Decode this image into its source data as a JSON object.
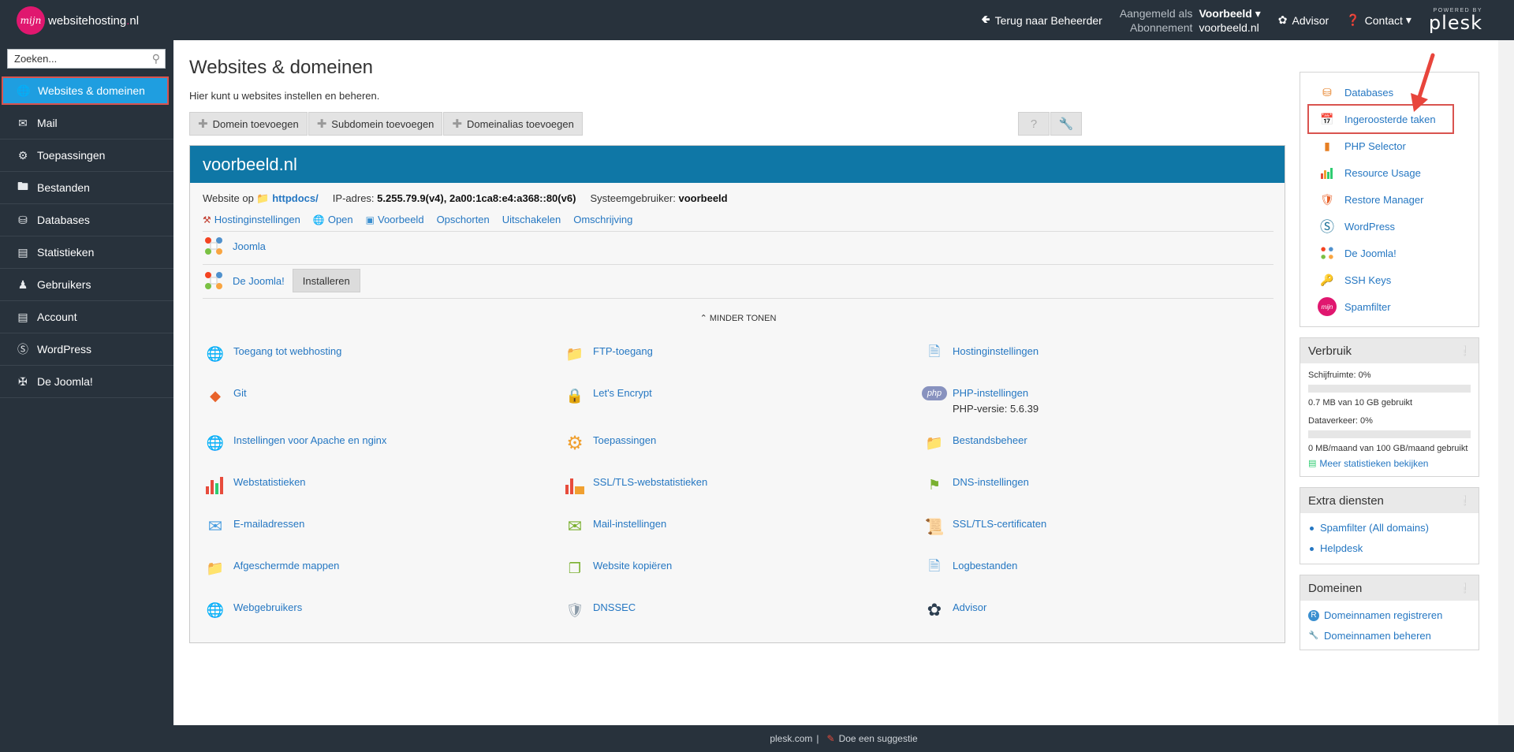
{
  "brand": {
    "logo_circle": "mijn",
    "name": "websitehosting",
    "tld_dot": ".",
    "tld": "nl"
  },
  "topbar": {
    "back_label": "Terug naar Beheerder",
    "logged_in_key": "Aangemeld als",
    "logged_in_user": "Voorbeeld",
    "subscription_key": "Abonnement",
    "subscription_value": "voorbeeld.nl",
    "advisor": "Advisor",
    "contact": "Contact",
    "powered_by": "POWERED BY",
    "plesk": "plesk"
  },
  "sidebar": {
    "search_placeholder": "Zoeken...",
    "items": [
      {
        "label": "Websites & domeinen",
        "icon": "globe-icon"
      },
      {
        "label": "Mail",
        "icon": "mail-icon"
      },
      {
        "label": "Toepassingen",
        "icon": "gear-icon"
      },
      {
        "label": "Bestanden",
        "icon": "folder-icon"
      },
      {
        "label": "Databases",
        "icon": "database-icon"
      },
      {
        "label": "Statistieken",
        "icon": "bar-chart-icon"
      },
      {
        "label": "Gebruikers",
        "icon": "user-icon"
      },
      {
        "label": "Account",
        "icon": "account-icon"
      },
      {
        "label": "WordPress",
        "icon": "wordpress-icon"
      },
      {
        "label": "De Joomla!",
        "icon": "joomla-icon"
      }
    ]
  },
  "main": {
    "title": "Websites & domeinen",
    "subtitle": "Hier kunt u websites instellen en beheren.",
    "toolbar": [
      "Domein toevoegen",
      "Subdomein toevoegen",
      "Domeinalias toevoegen"
    ],
    "help_icon": "?",
    "domain": {
      "name": "voorbeeld.nl",
      "website_op": "Website op",
      "docroot": "httpdocs/",
      "ip_label": "IP-adres:",
      "ip_value": "5.255.79.9(v4), 2a00:1ca8:e4:a368::80(v6)",
      "sysuser_label": "Systeemgebruiker:",
      "sysuser_value": "voorbeeld",
      "links": [
        "Hostinginstellingen",
        "Open",
        "Voorbeeld",
        "Opschorten",
        "Uitschakelen",
        "Omschrijving"
      ],
      "app1": "Joomla",
      "app2": "De Joomla!",
      "install": "Installeren",
      "less": "MINDER TONEN",
      "grid": [
        {
          "label": "Toegang tot webhosting",
          "icon": "hosting-access-icon"
        },
        {
          "label": "FTP-toegang",
          "icon": "ftp-icon"
        },
        {
          "label": "Hostinginstellingen",
          "icon": "hosting-settings-icon"
        },
        {
          "label": "Git",
          "icon": "git-icon"
        },
        {
          "label": "Let's Encrypt",
          "icon": "lets-encrypt-icon"
        },
        {
          "label": "PHP-instellingen",
          "icon": "php-icon",
          "sub": "PHP-versie: 5.6.39"
        },
        {
          "label": "Instellingen voor Apache en nginx",
          "icon": "apache-nginx-icon"
        },
        {
          "label": "Toepassingen",
          "icon": "applications-icon"
        },
        {
          "label": "Bestandsbeheer",
          "icon": "file-manager-icon"
        },
        {
          "label": "Webstatistieken",
          "icon": "web-stats-icon"
        },
        {
          "label": "SSL/TLS-webstatistieken",
          "icon": "ssl-stats-icon"
        },
        {
          "label": "DNS-instellingen",
          "icon": "dns-icon"
        },
        {
          "label": "E-mailadressen",
          "icon": "email-icon"
        },
        {
          "label": "Mail-instellingen",
          "icon": "mail-settings-icon"
        },
        {
          "label": "SSL/TLS-certificaten",
          "icon": "certificate-icon"
        },
        {
          "label": "Afgeschermde mappen",
          "icon": "protected-folder-icon"
        },
        {
          "label": "Website kopiëren",
          "icon": "copy-website-icon"
        },
        {
          "label": "Logbestanden",
          "icon": "logs-icon"
        },
        {
          "label": "Webgebruikers",
          "icon": "web-users-icon"
        },
        {
          "label": "DNSSEC",
          "icon": "dnssec-icon"
        },
        {
          "label": "Advisor",
          "icon": "advisor-icon"
        }
      ]
    }
  },
  "right": {
    "links": [
      {
        "label": "Databases",
        "icon": "database-icon"
      },
      {
        "label": "Ingeroosterde taken",
        "icon": "scheduled-tasks-icon"
      },
      {
        "label": "PHP Selector",
        "icon": "php-selector-icon"
      },
      {
        "label": "Resource Usage",
        "icon": "resource-usage-icon"
      },
      {
        "label": "Restore Manager",
        "icon": "restore-manager-icon"
      },
      {
        "label": "WordPress",
        "icon": "wordpress-icon"
      },
      {
        "label": "De Joomla!",
        "icon": "joomla-icon"
      },
      {
        "label": "SSH Keys",
        "icon": "ssh-keys-icon"
      },
      {
        "label": "Spamfilter",
        "icon": "spamfilter-icon"
      }
    ],
    "usage": {
      "title": "Verbruik",
      "disk_label": "Schijfruimte: 0%",
      "disk_fraction": 0,
      "disk_detail": "0.7 MB van 10 GB gebruikt",
      "traffic_label": "Dataverkeer: 0%",
      "traffic_fraction": 0,
      "traffic_detail": "0 MB/maand van 100 GB/maand gebruikt",
      "more": "Meer statistieken bekijken"
    },
    "extra": {
      "title": "Extra diensten",
      "items": [
        "Spamfilter (All domains)",
        "Helpdesk"
      ]
    },
    "domains": {
      "title": "Domeinen",
      "items": [
        "Domeinnamen registreren",
        "Domeinnamen beheren"
      ]
    }
  },
  "footer": {
    "left": "plesk.com",
    "sep": "|",
    "right": "Doe een suggestie"
  },
  "colors": {
    "topbar": "#28323c",
    "accent": "#1f9ee0",
    "domain_header": "#0f77a6",
    "brand": "#e0176f",
    "highlight": "#d9534f"
  }
}
